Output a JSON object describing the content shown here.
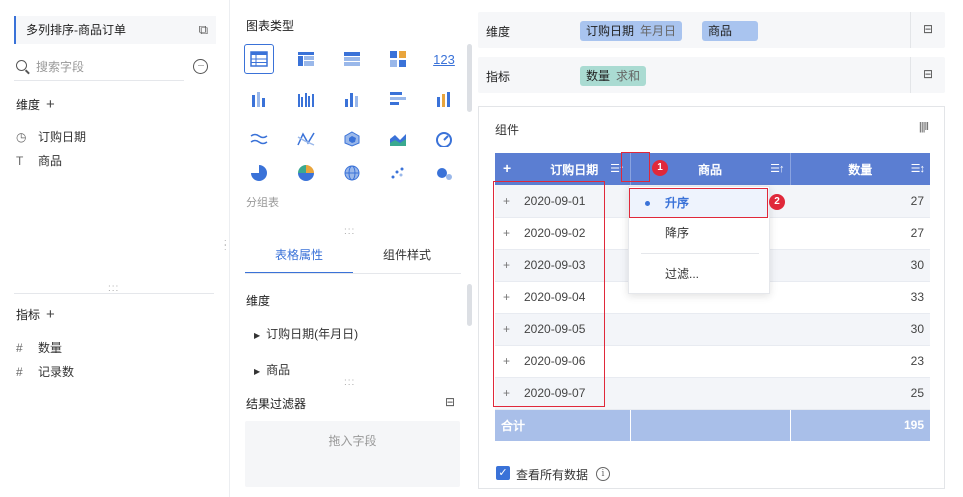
{
  "left_panel": {
    "title": "多列排序-商品订单",
    "search_placeholder": "搜索字段",
    "dimension_section": "维度",
    "dimensions": [
      "订购日期",
      "商品"
    ],
    "measure_section": "指标",
    "measures": [
      "数量",
      "记录数"
    ]
  },
  "middle_panel": {
    "chart_type_title": "图表类型",
    "group_label": "分组表",
    "tabs": [
      "表格属性",
      "组件样式"
    ],
    "dimension_label": "维度",
    "tree_items": [
      "订购日期(年月日)",
      "商品"
    ],
    "filter_title": "结果过滤器",
    "drop_hint": "拖入字段"
  },
  "shelves": {
    "dimension_label": "维度",
    "dimension_pills": [
      {
        "name": "订购日期",
        "sub": "年月日"
      },
      {
        "name": "商品",
        "sub": ""
      }
    ],
    "measure_label": "指标",
    "measure_pills": [
      {
        "name": "数量",
        "sub": "求和"
      }
    ]
  },
  "component": {
    "title": "组件",
    "columns": [
      "订购日期",
      "商品",
      "数量"
    ],
    "expand_all_label": "+",
    "rows": [
      {
        "date": "2020-09-01",
        "value": "27"
      },
      {
        "date": "2020-09-02",
        "value": "27"
      },
      {
        "date": "2020-09-03",
        "value": "30"
      },
      {
        "date": "2020-09-04",
        "value": "33"
      },
      {
        "date": "2020-09-05",
        "value": "30"
      },
      {
        "date": "2020-09-06",
        "value": "23"
      },
      {
        "date": "2020-09-07",
        "value": "25"
      }
    ],
    "total_label": "合计",
    "total_value": "195",
    "view_all_label": "查看所有数据"
  },
  "sort_menu": {
    "items": [
      "升序",
      "降序",
      "过滤..."
    ],
    "selected": "升序"
  },
  "callouts": [
    "1",
    "2"
  ],
  "colors": {
    "accent": "#3a72d8",
    "header_blue": "#5b7ed2",
    "total_blue": "#a9bfe9",
    "dimension_pill": "#a9c4ef",
    "measure_pill": "#aadbd2",
    "callout_red": "#e0283a"
  },
  "icons": [
    "search-icon",
    "more-icon",
    "duplicate-icon",
    "clock-icon",
    "text-type-icon",
    "hash-icon",
    "lock-icon",
    "sort-icon",
    "info-icon",
    "checkbox-icon",
    "expand-icon",
    "column-settings-icon"
  ]
}
